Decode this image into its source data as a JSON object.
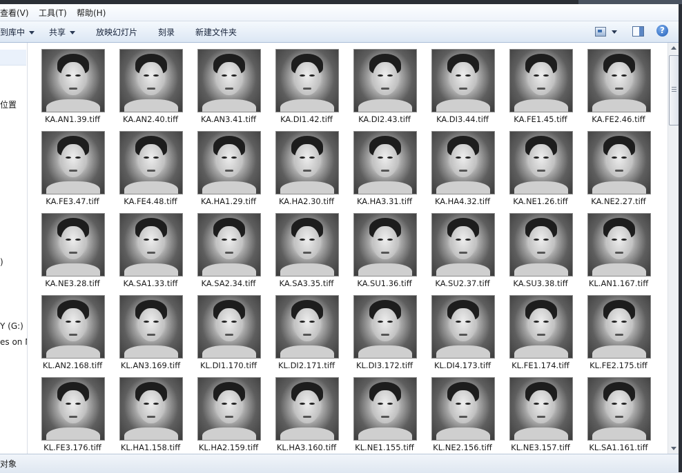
{
  "menubar": {
    "items": [
      "查看(V)",
      "工具(T)",
      "帮助(H)"
    ]
  },
  "toolbar": {
    "include_library": "到库中",
    "share": "共享",
    "slideshow": "放映幻灯片",
    "burn": "刻录",
    "new_folder": "新建文件夹"
  },
  "nav": {
    "items": [
      "位置",
      ")",
      "Y (G:)",
      "es on M"
    ]
  },
  "status": {
    "text": "对象"
  },
  "files": [
    "KA.AN1.39.tiff",
    "KA.AN2.40.tiff",
    "KA.AN3.41.tiff",
    "KA.DI1.42.tiff",
    "KA.DI2.43.tiff",
    "KA.DI3.44.tiff",
    "KA.FE1.45.tiff",
    "KA.FE2.46.tiff",
    "KA.FE3.47.tiff",
    "KA.FE4.48.tiff",
    "KA.HA1.29.tiff",
    "KA.HA2.30.tiff",
    "KA.HA3.31.tiff",
    "KA.HA4.32.tiff",
    "KA.NE1.26.tiff",
    "KA.NE2.27.tiff",
    "KA.NE3.28.tiff",
    "KA.SA1.33.tiff",
    "KA.SA2.34.tiff",
    "KA.SA3.35.tiff",
    "KA.SU1.36.tiff",
    "KA.SU2.37.tiff",
    "KA.SU3.38.tiff",
    "KL.AN1.167.tiff",
    "KL.AN2.168.tiff",
    "KL.AN3.169.tiff",
    "KL.DI1.170.tiff",
    "KL.DI2.171.tiff",
    "KL.DI3.172.tiff",
    "KL.DI4.173.tiff",
    "KL.FE1.174.tiff",
    "KL.FE2.175.tiff",
    "KL.FE3.176.tiff",
    "KL.HA1.158.tiff",
    "KL.HA2.159.tiff",
    "KL.HA3.160.tiff",
    "KL.NE1.155.tiff",
    "KL.NE2.156.tiff",
    "KL.NE3.157.tiff",
    "KL.SA1.161.tiff"
  ],
  "icons": {
    "view": "view-options-icon",
    "preview_pane": "preview-pane-icon",
    "help": "help-icon"
  }
}
